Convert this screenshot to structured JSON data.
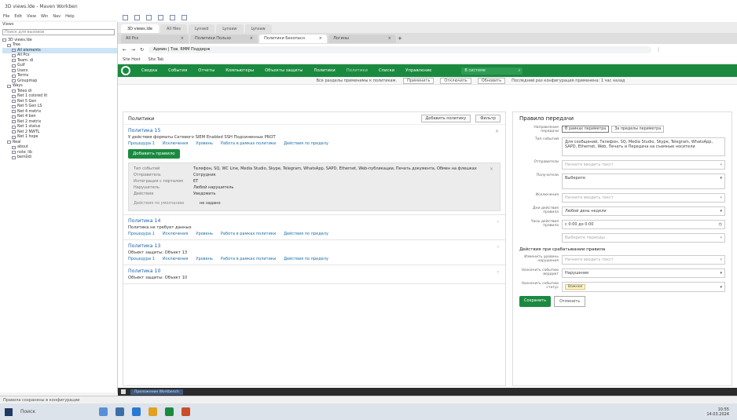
{
  "window": {
    "title": "3D views.lde - Maven Workben"
  },
  "menu": [
    "File",
    "Edit",
    "View",
    "Win",
    "Nav",
    "Help"
  ],
  "left_panel": {
    "header": "Views",
    "search_placeholder": "Поиск для вызовов",
    "tree": [
      {
        "label": "3D views.lde",
        "depth": 0
      },
      {
        "label": "Tree",
        "depth": 1
      },
      {
        "label": "All elements",
        "depth": 2,
        "selected": true
      },
      {
        "label": "All Pcs",
        "depth": 2
      },
      {
        "label": "Team: di",
        "depth": 2
      },
      {
        "label": "Gulf",
        "depth": 2
      },
      {
        "label": "Users",
        "depth": 2
      },
      {
        "label": "Terms",
        "depth": 2
      },
      {
        "label": "Groupmap",
        "depth": 2
      },
      {
        "label": "Ways",
        "depth": 1
      },
      {
        "label": "Teleo di",
        "depth": 2
      },
      {
        "label": "Net 1 colored lit",
        "depth": 2
      },
      {
        "label": "Net 5 Gen",
        "depth": 2
      },
      {
        "label": "Net 5 Gen LS",
        "depth": 2
      },
      {
        "label": "Net 4 metrix",
        "depth": 2
      },
      {
        "label": "Net 4 ben",
        "depth": 2
      },
      {
        "label": "Net 2 metrix",
        "depth": 2
      },
      {
        "label": "Net 1 status",
        "depth": 2
      },
      {
        "label": "Net 2 NWTL",
        "depth": 2
      },
      {
        "label": "Net 1 hope",
        "depth": 2
      },
      {
        "label": "Real",
        "depth": 1
      },
      {
        "label": "about",
        "depth": 2
      },
      {
        "label": "note_lib",
        "depth": 2
      },
      {
        "label": "bemodi",
        "depth": 2
      }
    ]
  },
  "browser": {
    "top_tabs": [
      "3D views.lde",
      "All files",
      "Lynsed",
      "Lynsaw",
      "Lynsaw"
    ],
    "tabs": [
      {
        "label": "All Pcs",
        "active": false
      },
      {
        "label": "Политики Пользо",
        "active": false
      },
      {
        "label": "Политики Безопасн",
        "active": true
      },
      {
        "label": "Логины",
        "active": false
      }
    ],
    "address": "Админ | Тов. RMM Поддерж",
    "bookmarks": [
      "Site Host",
      "Site Tab"
    ]
  },
  "site_nav": {
    "items": [
      "Сводка",
      "События",
      "Отчеты",
      "Компьютеры",
      "Объекты защиты",
      "Политики"
    ],
    "dim_items": [
      "Политики"
    ],
    "more_items": [
      "Списки",
      "Управление"
    ],
    "search_placeholder": "В системе"
  },
  "notice": {
    "text": "Все разделы применимы к политикам.",
    "buttons": [
      "Применить",
      "Отключить",
      "Обновить"
    ],
    "tail": "Последний раз конфигурация применена: 1 час назад"
  },
  "policies_panel": {
    "title": "Политики",
    "add_label": "Добавить политику",
    "filter_label": "Фильтр",
    "policies": [
      {
        "name": "Политика 15",
        "description": "У действия форматы Сетевого SIEM Enabled SSH Подсиненных PROT",
        "links": [
          "Процедура 1",
          "Исключения",
          "Уровень",
          "Работа в рамках политики",
          "Действия по пределу"
        ],
        "expanded": true,
        "add_rule_label": "Добавить правило",
        "rule": {
          "rows": [
            {
              "k": "Тип событий",
              "v": "Телефон, SQ, WC Line, Media Studio, Skype, Telegram, WhatsApp, SAPD, Ethernet, Web-публикации, Печать документа, Обмен на флешках"
            },
            {
              "k": "Отправитель",
              "v": "Сотрудник"
            },
            {
              "k": "Интеграция с порталом",
              "v": "ЕТ"
            },
            {
              "k": "Нарушитель",
              "v": "Любой нарушитель"
            },
            {
              "k": "Действия",
              "v": "Уведомить"
            }
          ],
          "no_add_label": "Действия по умолчанию",
          "no_add_value": "не задано"
        }
      },
      {
        "name": "Политика 14",
        "description": "Политика не требует данных",
        "links": [
          "Процедура 1",
          "Исключения",
          "Уровень",
          "Работа в рамках политики",
          "Действия по пределу"
        ]
      },
      {
        "name": "Политика 13",
        "description": "Объект защиты: Объект 13",
        "links": [
          "Процедура 1",
          "Исключения",
          "Уровень",
          "Работа в рамках политики",
          "Действия по пределу"
        ]
      },
      {
        "name": "Политика 10",
        "description": "Объект защиты: Объект 10",
        "links": []
      }
    ]
  },
  "rule_form": {
    "title": "Правило передачи",
    "fields": [
      {
        "label": "Направление передачи",
        "type": "seg",
        "options": [
          "В рамках периметра",
          "За пределы периметра"
        ]
      },
      {
        "label": "Тип событий",
        "type": "text",
        "value": "Для сообщений, Телефон, SQ, Media Studio, Skype, Telegram, WhatsApp, SAPD, Ethernet, Web, Печать и Передача на съемные носители"
      },
      {
        "label": "Отправители",
        "type": "select",
        "placeholder": "Начните вводить текст"
      },
      {
        "label": "Получатели",
        "type": "select",
        "value": "Выберите"
      },
      {
        "label": "Исключения",
        "type": "select",
        "placeholder": "Начните вводить текст"
      },
      {
        "label": "Дни действия правила",
        "type": "select",
        "value": "Любой день недели"
      },
      {
        "label": "Часы действия правила",
        "type": "time",
        "value": "с 0:00 до 0:00"
      },
      {
        "label": "",
        "type": "select",
        "placeholder": "Выберите периоды"
      }
    ],
    "actions_title": "Действия при срабатывании правила",
    "action_fields": [
      {
        "label": "Изменить уровень нарушения",
        "type": "select",
        "placeholder": "Начните вводить текст"
      },
      {
        "label": "Назначить событию вердикт",
        "type": "select",
        "value": "Нарушение"
      },
      {
        "label": "Назначить событию статус",
        "type": "chip",
        "value": "Важное"
      }
    ],
    "save_label": "Сохранить",
    "cancel_label": "Отменить"
  },
  "inner_taskbar": {
    "item": "Приложение Workbench"
  },
  "statusbar": "Правила сохранены в конфигурации",
  "taskbar": {
    "search": "Поиск",
    "time": "10:55",
    "date": "14.03.2024"
  },
  "colors": {
    "brand_green": "#1a8a3f",
    "link": "#1a6ea8"
  }
}
